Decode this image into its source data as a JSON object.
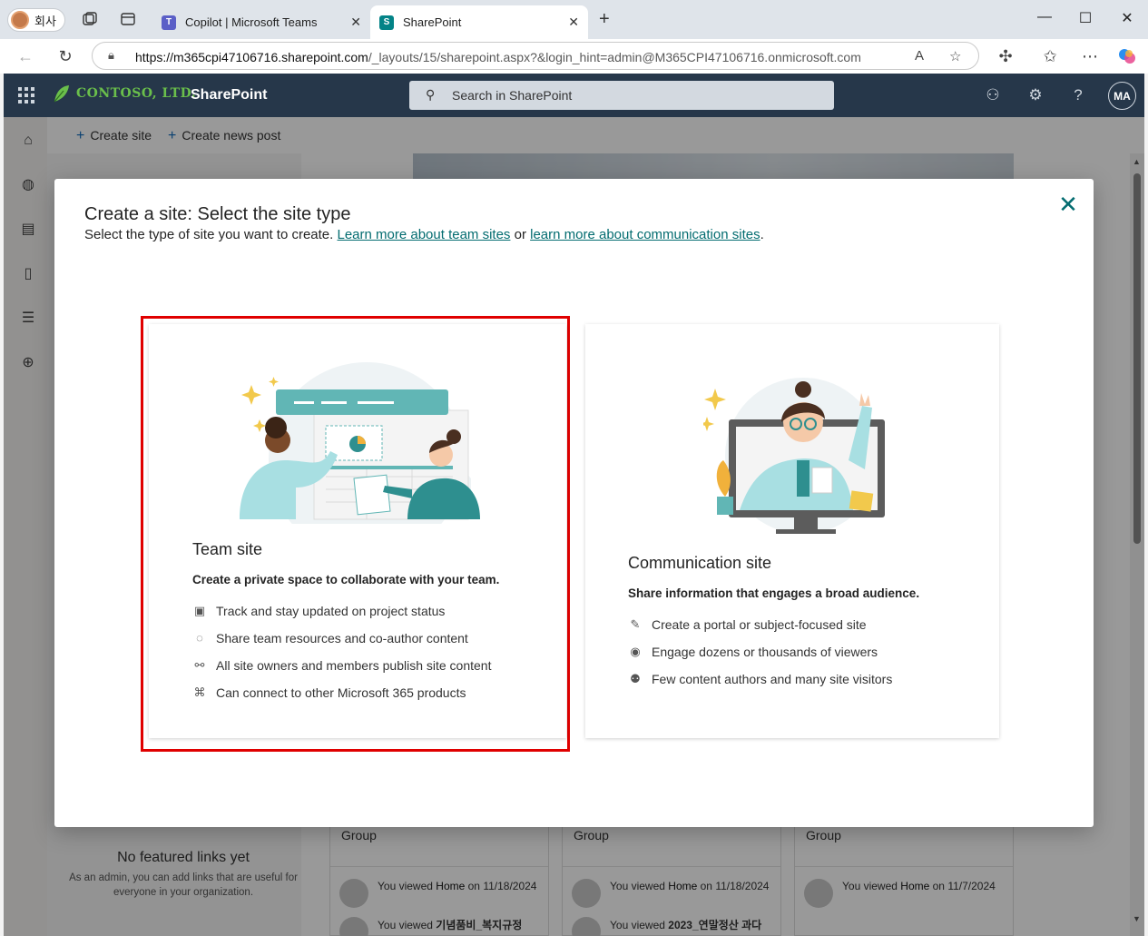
{
  "browser": {
    "profile_label": "회사",
    "tabs": [
      {
        "title": "Copilot | Microsoft Teams",
        "active": false
      },
      {
        "title": "SharePoint",
        "active": true
      }
    ],
    "url_host": "https://m365cpi47106716.sharepoint.com",
    "url_path": "/_layouts/15/sharepoint.aspx?&login_hint=admin@M365CPI47106716.onmicrosoft.com",
    "icons": [
      "back-icon",
      "refresh-icon",
      "lock-icon",
      "read-aloud-icon",
      "favorite-star-icon",
      "extensions-icon",
      "favorites-icon",
      "more-icon",
      "copilot-icon"
    ]
  },
  "suite": {
    "brand": "CONTOSO, LTD.",
    "app_name": "SharePoint",
    "search_placeholder": "Search in SharePoint",
    "avatar_initials": "MA"
  },
  "command_bar": {
    "create_site": "Create site",
    "create_news": "Create news post"
  },
  "background": {
    "no_links_title": "No featured links yet",
    "no_links_desc": "As an admin, you can add links that are useful for everyone in your organization.",
    "cards": [
      {
        "group": "Group",
        "activity": "You viewed",
        "bold": "Home",
        "rest": " on 11/18/2024",
        "activity2": "You viewed",
        "bold2": "기념품비_복지규정"
      },
      {
        "group": "Group",
        "activity": "You viewed",
        "bold": "Home",
        "rest": " on 11/18/2024",
        "activity2": "You viewed",
        "bold2": "2023_연말정산 과다"
      },
      {
        "group": "Group",
        "activity": "You viewed",
        "bold": "Home",
        "rest": " on 11/7/2024",
        "activity2": "",
        "bold2": ""
      }
    ]
  },
  "dialog": {
    "title": "Create a site: Select the site type",
    "subtitle_prefix": "Select the type of site you want to create.",
    "link_team": "Learn more about team sites",
    "subtitle_or": "or",
    "link_comm": "learn more about communication sites",
    "subtitle_suffix": ".",
    "options": {
      "team": {
        "title": "Team site",
        "description": "Create a private space to collaborate with your team.",
        "bullets": [
          "Track and stay updated on project status",
          "Share team resources and co-author content",
          "All site owners and members publish site content",
          "Can connect to other Microsoft 365 products"
        ]
      },
      "communication": {
        "title": "Communication site",
        "description": "Share information that engages a broad audience.",
        "bullets": [
          "Create a portal or subject-focused site",
          "Engage dozens or thousands of viewers",
          "Few content authors and many site visitors"
        ]
      }
    }
  },
  "colors": {
    "accent": "#036c70",
    "suite_bar": "#26374a",
    "highlight": "#e00000"
  }
}
